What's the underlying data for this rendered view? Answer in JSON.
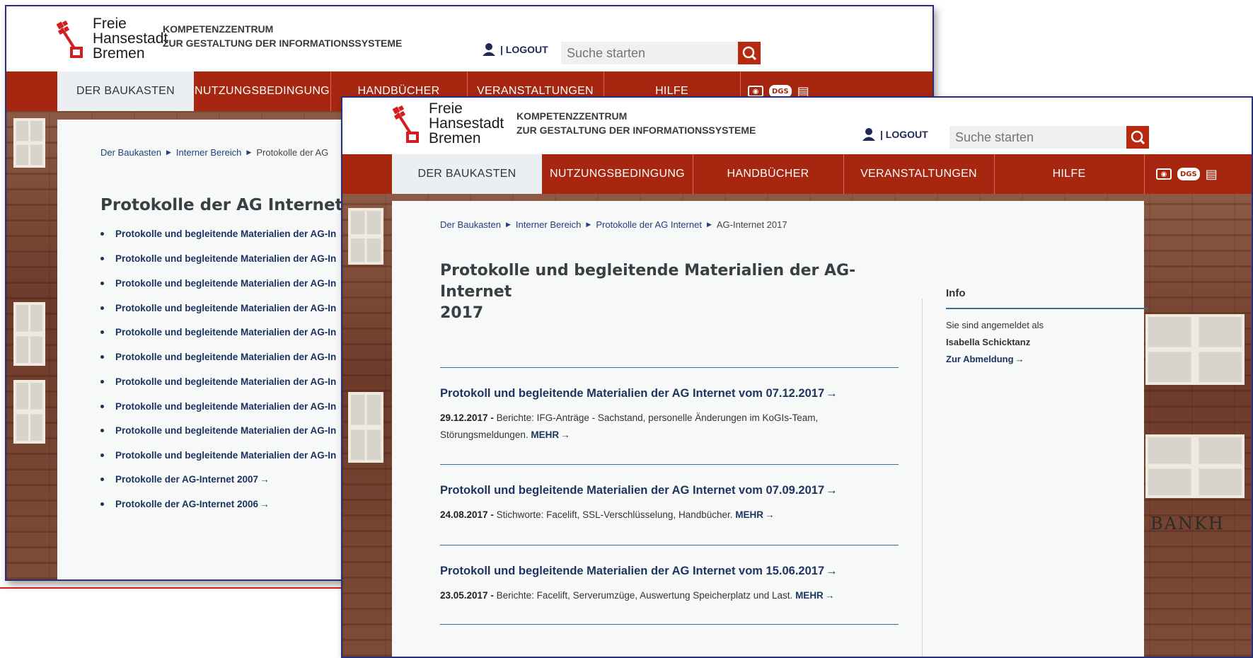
{
  "colors": {
    "accent": "#a6260f",
    "link": "#1e3561",
    "rule": "#3d6c94"
  },
  "logo": {
    "line1": "Freie",
    "line2": "Hansestadt",
    "line3": "Bremen",
    "icon": "bremen-key-icon"
  },
  "kompetenz": {
    "line1": "KOMPETENZZENTRUM",
    "line2": "ZUR GESTALTUNG DER INFORMATIONSSYSTEME"
  },
  "logout": {
    "label": "| LOGOUT",
    "icon": "user-icon"
  },
  "search": {
    "placeholder": "Suche starten",
    "icon": "search-icon"
  },
  "nav": {
    "items": [
      {
        "label": "DER BAUKASTEN"
      },
      {
        "label": "NUTZUNGSBEDINGUNG"
      },
      {
        "label": "HANDBÜCHER"
      },
      {
        "label": "VERANSTALTUNGEN"
      },
      {
        "label": "HILFE"
      }
    ],
    "icons": [
      {
        "name": "eye-icon",
        "glyph": "👁"
      },
      {
        "name": "sign-language-icon",
        "glyph": "DGS"
      },
      {
        "name": "easy-language-icon",
        "glyph": "📖"
      }
    ]
  },
  "back": {
    "breadcrumb": [
      "Der Baukasten",
      "Interner Bereich",
      "Protokolle der AG"
    ],
    "title": "Protokolle der AG Internet",
    "items": [
      "Protokolle und begleitende Materialien der AG-In",
      "Protokolle und begleitende Materialien der AG-In",
      "Protokolle und begleitende Materialien der AG-In",
      "Protokolle und begleitende Materialien der AG-In",
      "Protokolle und begleitende Materialien der AG-In",
      "Protokolle und begleitende Materialien der AG-In",
      "Protokolle und begleitende Materialien der AG-In",
      "Protokolle und begleitende Materialien der AG-In",
      "Protokolle und begleitende Materialien der AG-In",
      "Protokolle und begleitende Materialien der AG-In",
      "Protokolle der AG-Internet 2007",
      "Protokolle der AG-Internet 2006"
    ]
  },
  "front": {
    "breadcrumb": [
      "Der Baukasten",
      "Interner Bereich",
      "Protokolle der AG Internet",
      "AG-Internet 2017"
    ],
    "title_line1": "Protokolle und begleitende Materialien der AG-Internet",
    "title_line2": "2017",
    "articles": [
      {
        "title": "Protokoll und begleitende Materialien der AG Internet vom 07.12.2017",
        "date": "29.12.2017 -",
        "text1": "Berichte: IFG-Anträge - Sachstand, personelle Änderungen im KoGIs-Team,",
        "text2": "Störungsmeldungen.",
        "more": "MEHR"
      },
      {
        "title": "Protokoll und begleitende Materialien der AG Internet vom 07.09.2017",
        "date": "24.08.2017 -",
        "text1": "Stichworte: Facelift, SSL-Verschlüsselung, Handbücher.",
        "more": "MEHR"
      },
      {
        "title": "Protokoll und begleitende Materialien der AG Internet vom 15.06.2017",
        "date": "23.05.2017 -",
        "text1": "Berichte: Facelift, Serverumzüge, Auswertung Speicherplatz und Last.",
        "more": "MEHR"
      }
    ],
    "info": {
      "heading": "Info",
      "line1": "Sie sind angemeldet als",
      "user": "Isabella Schicktanz",
      "logout_link": "Zur Abmeldung"
    }
  },
  "background_sign": "BANKH"
}
